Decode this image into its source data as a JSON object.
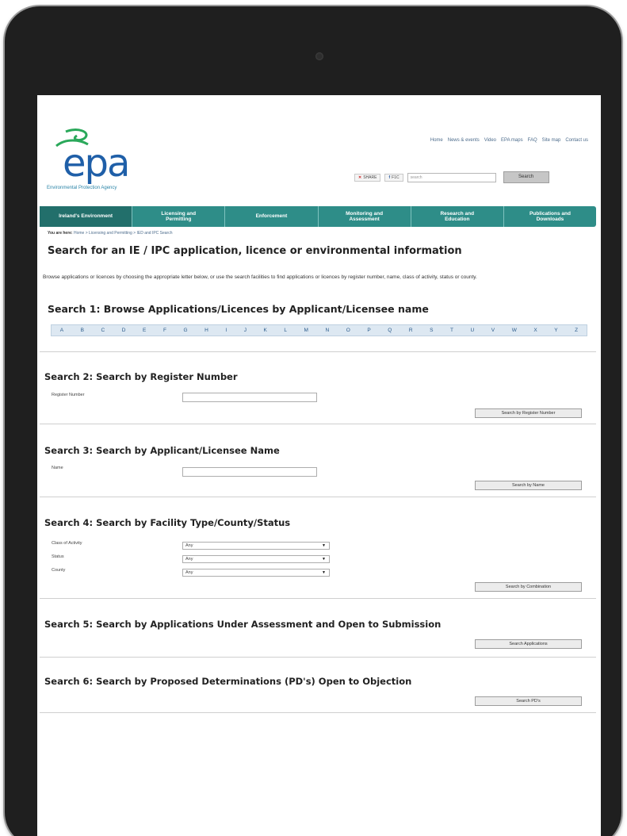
{
  "site": {
    "logo_text": "epa",
    "logo_tagline": "Environmental Protection Agency"
  },
  "top_links": [
    "Home",
    "News & events",
    "Video",
    "EPA maps",
    "FAQ",
    "Site map",
    "Contact us"
  ],
  "share": {
    "x_label": "SHARE",
    "f_label": "F1C"
  },
  "search": {
    "placeholder": "search",
    "button_label": "Search"
  },
  "nav": [
    "Ireland's Environment",
    "Licensing and\nPermitting",
    "Enforcement",
    "Monitoring and\nAssessment",
    "Research and\nEducation",
    "Publications and\nDownloads"
  ],
  "breadcrumb": {
    "prefix": "You are here:",
    "trail": "Home > Licensing and Permitting > IED and IPC Search"
  },
  "page_title": "Search for an IE / IPC application, licence or environmental information",
  "intro": "Browse applications or licences by choosing the appropriate letter below, or use the search facilities to find applications or licences by register number, name, class of activity, status or county.",
  "search1": {
    "heading": "Search 1: Browse Applications/Licences by Applicant/Licensee name",
    "letters": [
      "A",
      "B",
      "C",
      "D",
      "E",
      "F",
      "G",
      "H",
      "I",
      "J",
      "K",
      "L",
      "M",
      "N",
      "O",
      "P",
      "Q",
      "R",
      "S",
      "T",
      "U",
      "V",
      "W",
      "X",
      "Y",
      "Z"
    ]
  },
  "search2": {
    "heading": "Search 2: Search by Register Number",
    "field_label": "Register Number",
    "button_label": "Search by Register Number"
  },
  "search3": {
    "heading": "Search 3: Search by Applicant/Licensee Name",
    "field_label": "Name",
    "button_label": "Search by Name"
  },
  "search4": {
    "heading": "Search 4: Search by Facility Type/County/Status",
    "fields": [
      {
        "label": "Class of Activity",
        "value": "Any"
      },
      {
        "label": "Status",
        "value": "Any"
      },
      {
        "label": "County",
        "value": "Any"
      }
    ],
    "button_label": "Search by Combination"
  },
  "search5": {
    "heading": "Search 5: Search by Applications Under Assessment and Open to Submission",
    "button_label": "Search Applications"
  },
  "search6": {
    "heading": "Search 6: Search by Proposed Determinations (PD's) Open to Objection",
    "button_label": "Search PD's"
  },
  "colors": {
    "nav_bg": "#2e8d88",
    "logo_blue": "#1f5fa8",
    "frame": "#1f1f1f"
  }
}
